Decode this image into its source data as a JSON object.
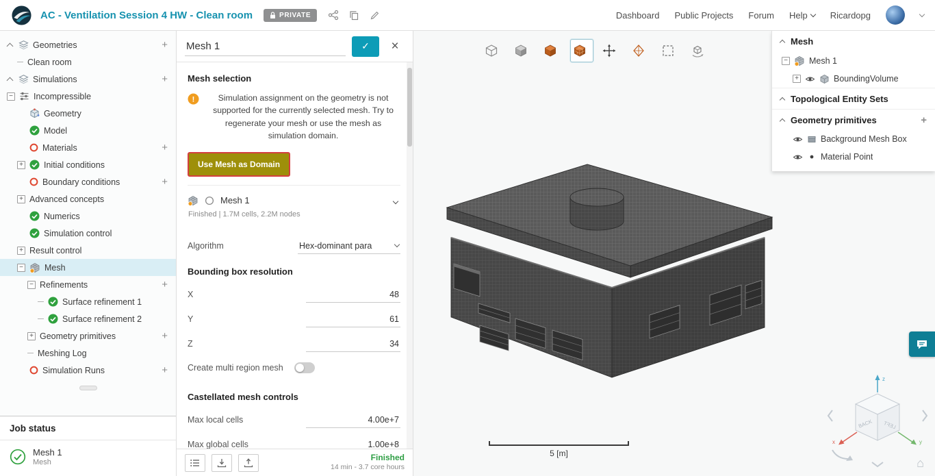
{
  "header": {
    "title": "AC - Ventilation Session 4 HW - Clean room",
    "private_badge": "PRIVATE",
    "nav": [
      "Dashboard",
      "Public Projects",
      "Forum",
      "Help"
    ],
    "username": "Ricardopg"
  },
  "sidebar": {
    "tree": [
      {
        "label": "Geometries",
        "indent": 0,
        "expander": "caret",
        "icon": "layers",
        "plus": true,
        "selected": false
      },
      {
        "label": "Clean room",
        "indent": 1,
        "expander": "dash",
        "icon": null,
        "plus": false,
        "selected": false
      },
      {
        "label": "Simulations",
        "indent": 0,
        "expander": "caret",
        "icon": "layers",
        "plus": true,
        "selected": false
      },
      {
        "label": "Incompressible",
        "indent": 0,
        "expander": "minus",
        "icon": "sim",
        "plus": false,
        "selected": false
      },
      {
        "label": "Geometry",
        "indent": 1,
        "expander": "none",
        "icon": "geometry",
        "plus": false,
        "selected": false
      },
      {
        "label": "Model",
        "indent": 1,
        "expander": "none",
        "icon": "check",
        "plus": false,
        "selected": false
      },
      {
        "label": "Materials",
        "indent": 1,
        "expander": "none",
        "icon": "red-o",
        "plus": true,
        "selected": false
      },
      {
        "label": "Initial conditions",
        "indent": 1,
        "expander": "plus",
        "icon": "check",
        "plus": false,
        "selected": false
      },
      {
        "label": "Boundary conditions",
        "indent": 1,
        "expander": "none",
        "icon": "red-o",
        "plus": true,
        "selected": false
      },
      {
        "label": "Advanced concepts",
        "indent": 1,
        "expander": "plus",
        "icon": null,
        "plus": false,
        "selected": false
      },
      {
        "label": "Numerics",
        "indent": 1,
        "expander": "none",
        "icon": "check",
        "plus": false,
        "selected": false
      },
      {
        "label": "Simulation control",
        "indent": 1,
        "expander": "none",
        "icon": "check",
        "plus": false,
        "selected": false
      },
      {
        "label": "Result control",
        "indent": 1,
        "expander": "plus",
        "icon": null,
        "plus": false,
        "selected": false
      },
      {
        "label": "Mesh",
        "indent": 1,
        "expander": "minus",
        "icon": "mesh-warn",
        "plus": false,
        "selected": true
      },
      {
        "label": "Refinements",
        "indent": 2,
        "expander": "minus",
        "icon": null,
        "plus": true,
        "selected": false
      },
      {
        "label": "Surface refinement 1",
        "indent": 3,
        "expander": "dash",
        "icon": "check",
        "plus": false,
        "selected": false
      },
      {
        "label": "Surface refinement 2",
        "indent": 3,
        "expander": "dash",
        "icon": "check",
        "plus": false,
        "selected": false
      },
      {
        "label": "Geometry primitives",
        "indent": 2,
        "expander": "plus",
        "icon": null,
        "plus": true,
        "selected": false
      },
      {
        "label": "Meshing Log",
        "indent": 2,
        "expander": "dash",
        "icon": null,
        "plus": false,
        "selected": false
      },
      {
        "label": "Simulation Runs",
        "indent": 1,
        "expander": "none",
        "icon": "red-o",
        "plus": true,
        "selected": false
      }
    ],
    "job_status": {
      "title": "Job status",
      "job_name": "Mesh 1",
      "job_type": "Mesh"
    }
  },
  "panel": {
    "title": "Mesh 1",
    "mesh_selection_heading": "Mesh selection",
    "warning_text": "Simulation assignment on the geometry is not supported for the currently selected mesh. Try to regenerate your mesh or use the mesh as simulation domain.",
    "use_mesh_button": "Use Mesh as Domain",
    "mesh_item": {
      "name": "Mesh 1",
      "meta": "Finished | 1.7M cells, 2.2M nodes"
    },
    "algorithm": {
      "label": "Algorithm",
      "value": "Hex-dominant para"
    },
    "bbox_heading": "Bounding box resolution",
    "bbox_fields": [
      {
        "label": "X",
        "value": "48"
      },
      {
        "label": "Y",
        "value": "61"
      },
      {
        "label": "Z",
        "value": "34"
      }
    ],
    "multi_region_label": "Create multi region mesh",
    "castellated_heading": "Castellated mesh controls",
    "cell_fields": [
      {
        "label": "Max local cells",
        "value": "4.00e+7"
      },
      {
        "label": "Max global cells",
        "value": "1.00e+8"
      }
    ],
    "footer": {
      "status": "Finished",
      "meta": "14 min - 3.7 core hours"
    }
  },
  "right_panel": {
    "sections": [
      {
        "title": "Mesh",
        "plus": false,
        "rows": [
          {
            "label": "Mesh 1",
            "expander": "minus",
            "icons": [
              "mesh-warn"
            ],
            "indent": 0
          },
          {
            "label": "BoundingVolume",
            "expander": "plus",
            "icons": [
              "eye",
              "cube-outline"
            ],
            "indent": 1
          }
        ]
      },
      {
        "title": "Topological Entity Sets",
        "plus": false,
        "rows": []
      },
      {
        "title": "Geometry primitives",
        "plus": true,
        "rows": [
          {
            "label": "Background Mesh Box",
            "expander": "none",
            "icons": [
              "eye",
              "box-filled"
            ],
            "indent": 1
          },
          {
            "label": "Material Point",
            "expander": "none",
            "icons": [
              "eye",
              "dot"
            ],
            "indent": 1
          }
        ]
      }
    ]
  },
  "viewport": {
    "toolbar": [
      {
        "name": "isometric-view",
        "selected": false
      },
      {
        "name": "shaded-view",
        "selected": false
      },
      {
        "name": "solid-mesh-view",
        "selected": false
      },
      {
        "name": "surface-mesh-view",
        "selected": true
      },
      {
        "name": "move-tool",
        "selected": false
      },
      {
        "name": "clip-plane-tool",
        "selected": false
      },
      {
        "name": "box-select-tool",
        "selected": false
      },
      {
        "name": "transform-tool",
        "selected": false
      }
    ],
    "scale_label": "5 [m]",
    "nav_cube": {
      "back_label": "BACK",
      "left_label": "LEFT",
      "x_label": "x",
      "y_label": "y",
      "z_label": "z"
    }
  },
  "colors": {
    "brand_teal": "#1792af",
    "confirm_teal": "#0d9cb7",
    "warning_orange": "#f09d20",
    "success_green": "#2e9e44",
    "error_red": "#df4730",
    "selected_row": "#d9eef5",
    "domain_button": "#9e8f0a",
    "domain_button_border": "#d43f3f",
    "mesh_orange": "#c05f1d"
  }
}
